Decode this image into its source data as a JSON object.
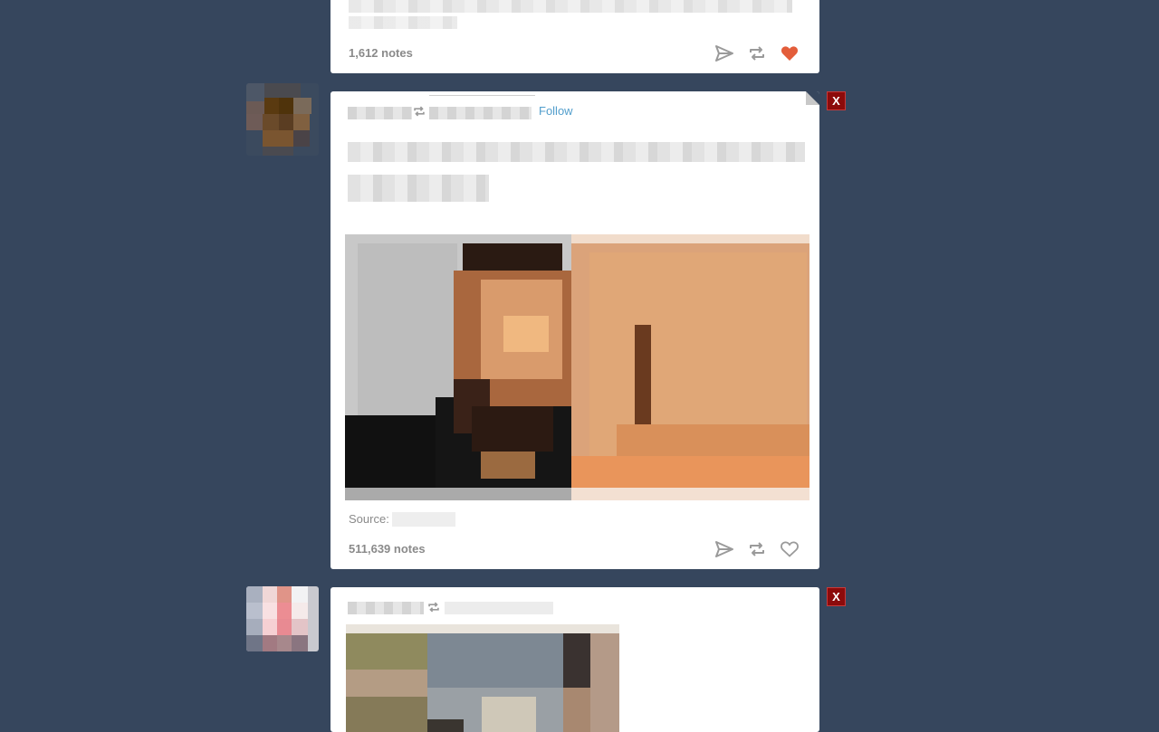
{
  "posts": [
    {
      "notes": "1,612 notes",
      "liked": true
    },
    {
      "follow_label": "Follow",
      "source_label": "Source:",
      "notes": "511,639 notes",
      "liked": false
    },
    {
      "notes": ""
    }
  ],
  "close_label": "X",
  "colors": {
    "background": "#36465d",
    "like_active": "#e35d3a",
    "link": "#529ecc",
    "close": "#8c0b0b"
  },
  "icons": {
    "share": "paper-plane-icon",
    "reblog": "reblog-icon",
    "like": "heart-icon"
  }
}
